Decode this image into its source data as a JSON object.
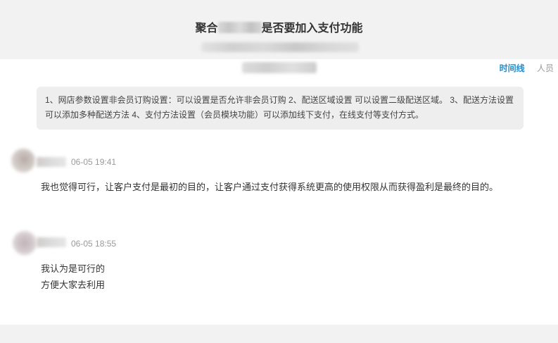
{
  "header": {
    "title_prefix": "聚合",
    "title_suffix": "是否要加入支付功能"
  },
  "tabs": [
    {
      "label": "时间线",
      "active": true
    },
    {
      "label": "人员",
      "active": false
    }
  ],
  "summary": {
    "text": "1、网店参数设置非会员订购设置：可以设置是否允许非会员订购 2、配送区域设置 可以设置二级配送区域。 3、配送方法设置 可以添加多种配送方法 4、支付方法设置（会员模块功能）可以添加线下支付，在线支付等支付方式。"
  },
  "comments": [
    {
      "time": "06-05 19:41",
      "text": "我也觉得可行，让客户支付是最初的目的，让客户通过支付获得系统更高的使用权限从而获得盈利是最终的目的。",
      "lines": []
    },
    {
      "time": "06-05 18:55",
      "text": "",
      "lines": [
        "我认为是可行的",
        "方便大家去利用"
      ]
    }
  ],
  "colors": {
    "accent": "#1a8fd6",
    "header_bg": "#f2f2f2",
    "summary_bg": "#eeeeee"
  }
}
